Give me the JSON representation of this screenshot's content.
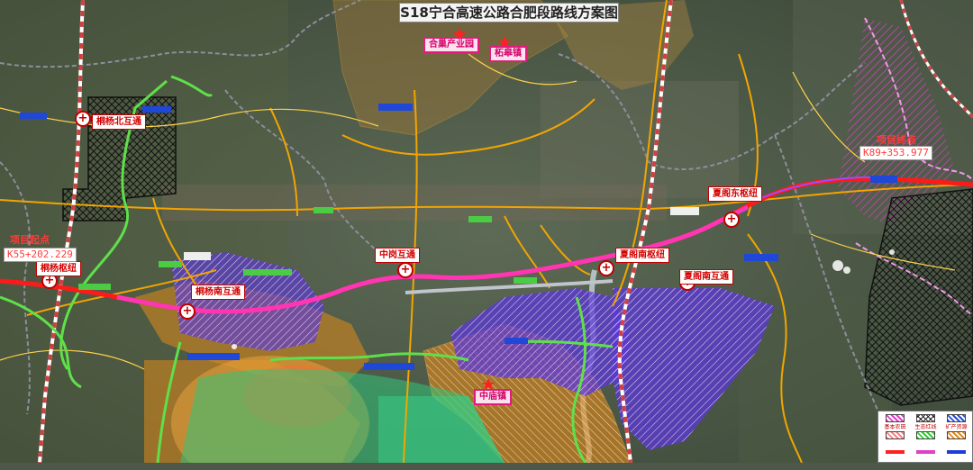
{
  "title": "S18宁合高速公路合肥段路线方案图",
  "route_color": "#e8005a",
  "chainages": {
    "start_label": "项目起点",
    "start_chainage": "K55+202.229",
    "end_label": "项目终点",
    "end_chainage": "K89+353.977"
  },
  "interchanges": {
    "tongyang_north": "桐杨北互通",
    "tongyang_hub": "桐杨枢纽",
    "tongyang_south": "桐杨南互通",
    "zhonggang": "中岗互通",
    "xiage_south_hub": "夏阁南枢纽",
    "xiage_south_ic": "夏阁南互通",
    "xiage_east_hub": "夏阁东枢纽"
  },
  "places": {
    "hefei_industrial_park": "合巢产业园",
    "zhegao_town": "柘皋镇",
    "zhongmiao": "中庙镇"
  },
  "legend": [
    {
      "label": "基本农田",
      "color": "#e040c8",
      "icon": "hatch-swatch"
    },
    {
      "label": "生态红线",
      "color": "#222222",
      "icon": "crosshatch-swatch"
    },
    {
      "label": "矿产资源",
      "color": "#2a4fd8",
      "icon": "hatch-swatch"
    },
    {
      "label": "",
      "color": "#ff8080",
      "icon": "hatch-swatch"
    },
    {
      "label": "",
      "color": "#33cc33",
      "icon": "hatch-swatch"
    },
    {
      "label": "",
      "color": "#e08a1a",
      "icon": "hatch-swatch"
    },
    {
      "label": "",
      "color": "#ff2020",
      "icon": "line-swatch"
    },
    {
      "label": "",
      "color": "#e040c8",
      "icon": "line-swatch"
    },
    {
      "label": "",
      "color": "#1f3bd8",
      "icon": "line-swatch"
    }
  ]
}
